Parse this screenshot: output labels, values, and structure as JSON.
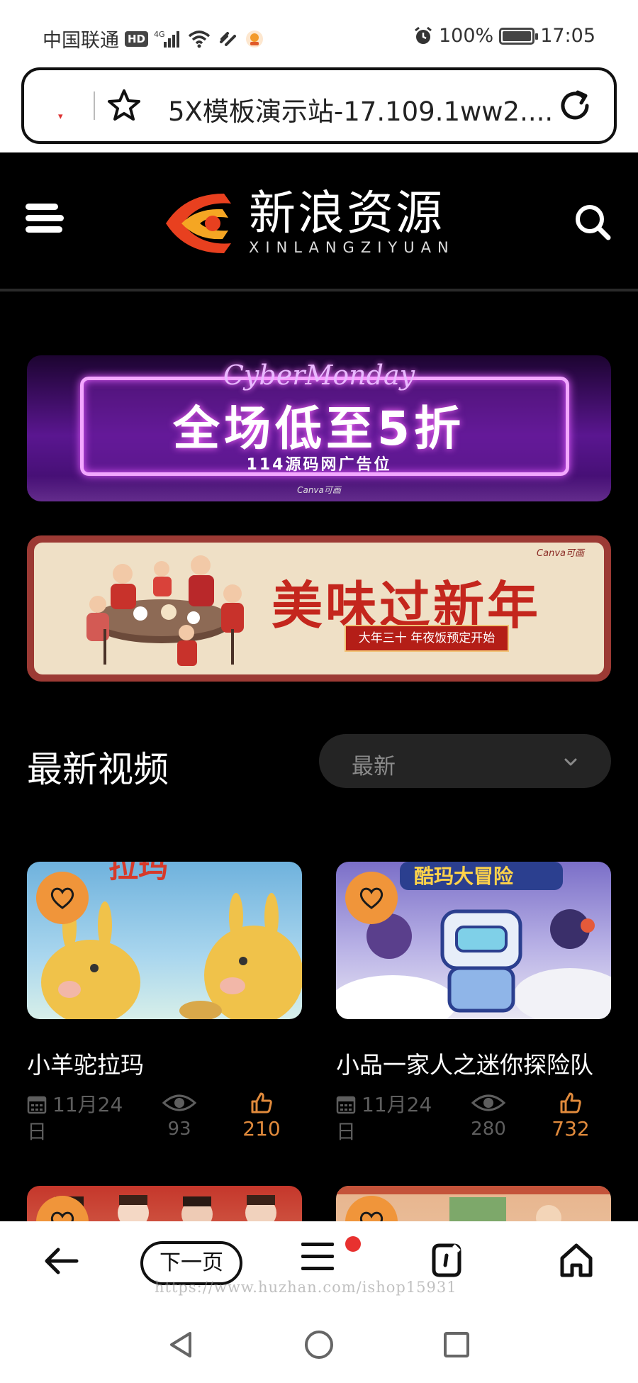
{
  "status_bar": {
    "carrier": "中国联通",
    "hd": "HD",
    "network": "4G",
    "battery": "100%",
    "battery_level": 1.0,
    "time": "17:05"
  },
  "address_bar": {
    "page_title": "5X模板演示站-17.109.1ww2...."
  },
  "site": {
    "logo_cn": "新浪资源",
    "logo_en": "XINLANGZIYUAN",
    "brand_color": "#e8401f",
    "accent_color": "#f0953a"
  },
  "banners": [
    {
      "script": "CyberMonday",
      "main": "全场低至5折",
      "sub": "114源码网广告位",
      "canva": "Canva可画"
    },
    {
      "title": "美味过新年",
      "ribbon": "大年三十 年夜饭预定开始",
      "canva": "Canva可画"
    }
  ],
  "section": {
    "title": "最新视频",
    "sort_selected": "最新"
  },
  "videos": [
    {
      "title": "小羊驼拉玛",
      "date": "11月24日",
      "views": "93",
      "likes": "210",
      "thumb_text": "拉玛"
    },
    {
      "title": "小品一家人之迷你探险队",
      "date": "11月24日",
      "views": "280",
      "likes": "732",
      "thumb_text": "酷玛大冒险"
    },
    {
      "title": "",
      "date": "",
      "views": "",
      "likes": ""
    },
    {
      "title": "",
      "date": "",
      "views": "",
      "likes": ""
    }
  ],
  "toolbar": {
    "next_page": "下一页",
    "watermark": "https://www.huzhan.com/ishop15931"
  },
  "icons": {
    "menu": "hamburger-icon",
    "search": "search-icon",
    "favorite": "heart-icon",
    "calendar": "calendar-icon",
    "views": "eye-icon",
    "likes": "thumbs-up-icon"
  }
}
